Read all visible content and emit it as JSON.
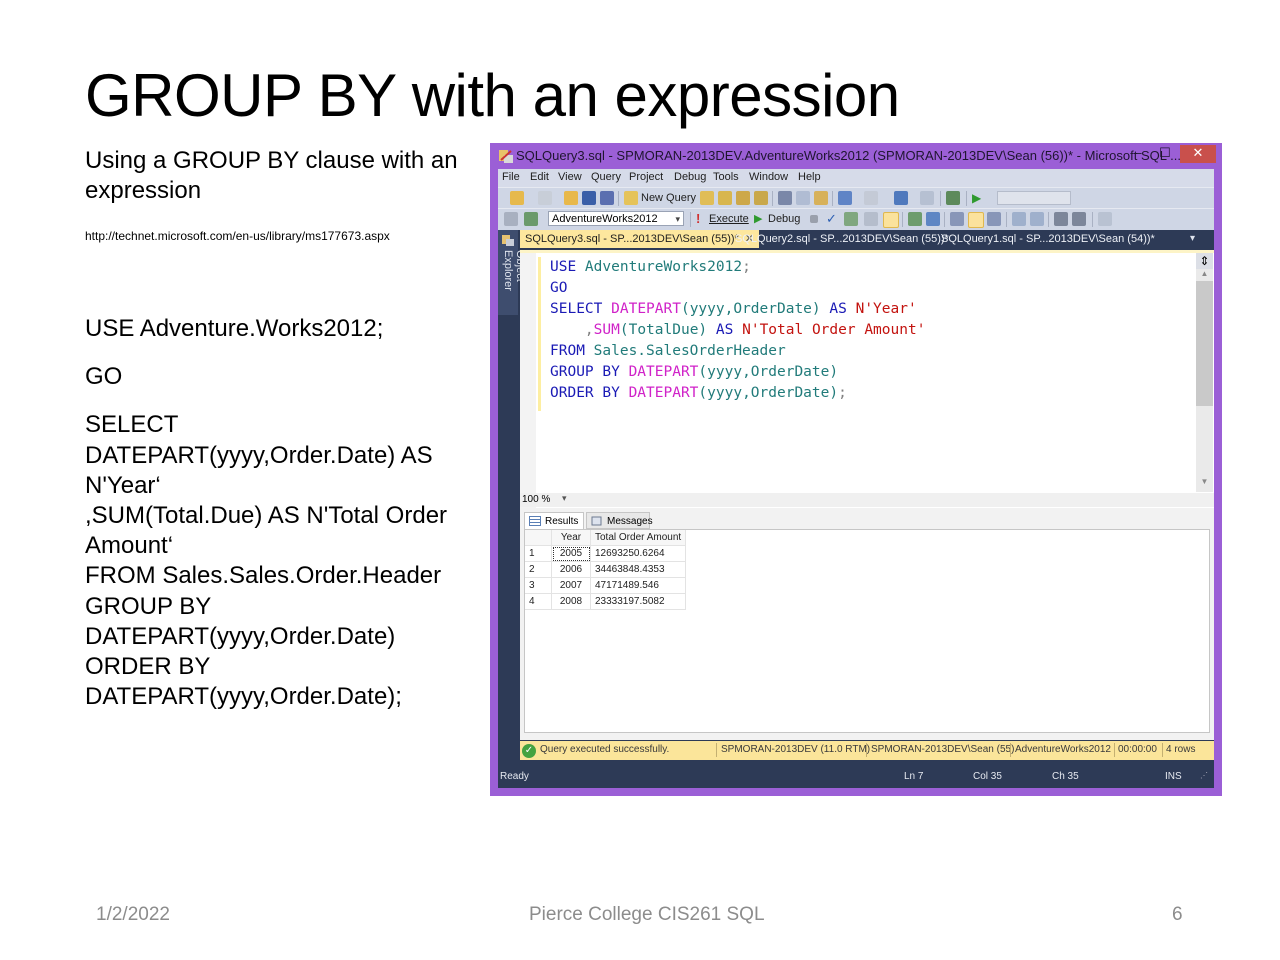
{
  "slide": {
    "title": "GROUP BY with an expression",
    "subtitle": "Using a GROUP BY clause with an expression",
    "link": "http://technet.microsoft.com/en-us/library/ms177673.aspx",
    "code": {
      "use": "USE Adventure.Works2012;",
      "go": "GO",
      "select_lines": [
        "SELECT",
        "DATEPART(yyyy,Order.Date) AS",
        "N'Year‘",
        ",SUM(Total.Due) AS N'Total Order",
        "Amount‘",
        "FROM Sales.Sales.Order.Header",
        "GROUP BY",
        "DATEPART(yyyy,Order.Date)",
        "ORDER BY",
        "DATEPART(yyyy,Order.Date);"
      ]
    },
    "footer": {
      "date": "1/2/2022",
      "center": "Pierce College CIS261 SQL",
      "page": "6"
    }
  },
  "ssms": {
    "window_title": "SQLQuery3.sql - SPMORAN-2013DEV.AdventureWorks2012 (SPMORAN-2013DEV\\Sean (56))* - Microsoft SQL ...",
    "window_controls": {
      "minimize": "–",
      "maximize": "☐",
      "close": "✕"
    },
    "colors": {
      "frame": "#9b5fd6",
      "chrome": "#2d3a56",
      "active_tab": "#fde79e",
      "close": "#c9504c",
      "status": "#fbe59a"
    },
    "menu": [
      "File",
      "Edit",
      "View",
      "Query",
      "Project",
      "Debug",
      "Tools",
      "Window",
      "Help"
    ],
    "toolbar": {
      "new_query": "New Query",
      "database": "AdventureWorks2012",
      "execute": "Execute",
      "debug": "Debug"
    },
    "object_explorer_label": "Object Explorer",
    "tabs": [
      {
        "label": "SQLQuery3.sql - SP...2013DEV\\Sean (55))*",
        "active": true,
        "close": "✕"
      },
      {
        "label": "SQLQuery2.sql - SP...2013DEV\\Sean (55))*",
        "active": false
      },
      {
        "label": "SQLQuery1.sql - SP...2013DEV\\Sean (54))*",
        "active": false
      }
    ],
    "tab_overflow": "▾",
    "editor": {
      "line1": {
        "kw": "USE",
        "ident": " AdventureWorks2012",
        "punct": ";"
      },
      "line2": {
        "kw": "GO"
      },
      "line3": {
        "kw": "SELECT",
        "fn": "DATEPART",
        "args": "(yyyy,OrderDate)",
        "as": "AS",
        "str": "N'Year'"
      },
      "line4": {
        "lead": "    ,",
        "fn": "SUM",
        "args": "(TotalDue)",
        "as": "AS",
        "str": "N'Total Order Amount'"
      },
      "line5": {
        "kw": "FROM",
        "ident": " Sales.SalesOrderHeader"
      },
      "line6": {
        "kw": "GROUP BY",
        "fn": "DATEPART",
        "args": "(yyyy,OrderDate)"
      },
      "line7": {
        "kw": "ORDER BY",
        "fn": "DATEPART",
        "args": "(yyyy,OrderDate)",
        "punct": ";"
      }
    },
    "zoom_level": "100 %",
    "results_tabs": {
      "results": "Results",
      "messages": "Messages"
    },
    "results": {
      "columns": [
        "",
        "Year",
        "Total Order Amount"
      ],
      "rows": [
        [
          "1",
          "2005",
          "12693250.6264"
        ],
        [
          "2",
          "2006",
          "34463848.4353"
        ],
        [
          "3",
          "2007",
          "47171489.546"
        ],
        [
          "4",
          "2008",
          "23333197.5082"
        ]
      ]
    },
    "query_status": {
      "message": "Query executed successfully.",
      "server": "SPMORAN-2013DEV (11.0 RTM)",
      "user": "SPMORAN-2013DEV\\Sean (55)",
      "database": "AdventureWorks2012",
      "elapsed": "00:00:00",
      "rows": "4 rows"
    },
    "statusbar": {
      "state": "Ready",
      "ln": "Ln 7",
      "col": "Col 35",
      "ch": "Ch 35",
      "mode": "INS"
    }
  }
}
